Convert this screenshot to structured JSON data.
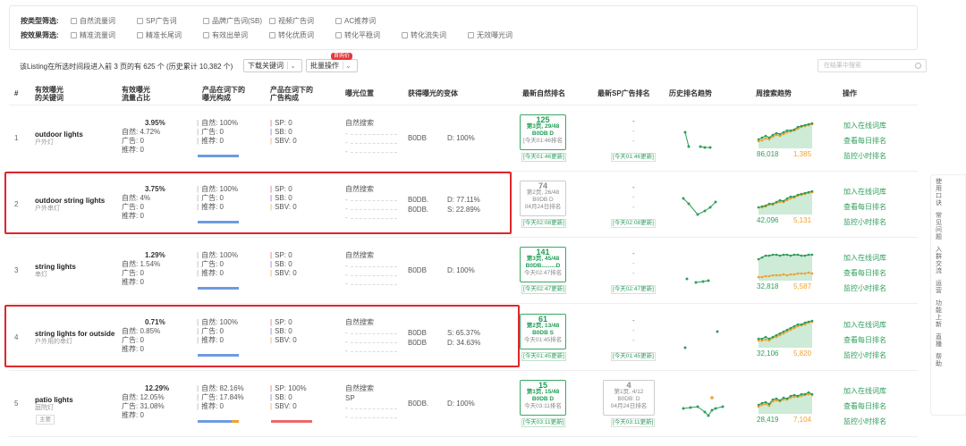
{
  "filters": {
    "type_label": "按类型筛选:",
    "type_options": [
      "自然流量词",
      "SP广告词",
      "品牌广告词(SB)",
      "视频广告词",
      "AC推荐词"
    ],
    "effect_label": "按效果筛选:",
    "effect_options": [
      "精准流量词",
      "精准长尾词",
      "有效出单词",
      "转化优质词",
      "转化平稳词",
      "转化流失词",
      "无效曝光词"
    ]
  },
  "toolbar": {
    "summary": "该Listing在所选时间段进入前 3 页的有 625 个 (历史累计 10,382 个)",
    "download_label": "下载关键词",
    "batch_label": "批量操作",
    "badge": "首购价",
    "search_placeholder": "在结果中搜索"
  },
  "columns": [
    "#",
    "有效曝光\n的关键词",
    "有效曝光\n流量占比",
    "产品在词下的\n曝光构成",
    "产品在词下的\n广告构成",
    "曝光位置",
    "获得曝光的变体",
    "最新自然排名",
    "最新SP广告排名",
    "历史排名趋势",
    "周搜索趋势",
    "操作"
  ],
  "rows": [
    {
      "idx": "1",
      "kw": "outdoor lights",
      "kw_cn": "户外灯",
      "share": "3.95%",
      "nat": "自然: 4.72%",
      "ad": "广告: 0",
      "rec": "推荐: 0",
      "exp_nat": "自然: 100%",
      "exp_ad": "广告: 0",
      "exp_rec": "推荐: 0",
      "sp": "SP: 0",
      "sb": "SB: 0",
      "sbv": "SBV: 0",
      "pos": "自然搜索",
      "var1": "B0DB",
      "var1p": "D: 100%",
      "var2": "",
      "var2p": "",
      "rank_num": "125",
      "rank_l1": "第3页, 29/48",
      "rank_l2": "B0DB          D",
      "rank_l3": "[今天01:46排名",
      "rank_upd": "[今天01:46更新]",
      "sp_rank": "-",
      "sp_upd": "[今天01:46更新]",
      "trend_a": "86,018",
      "trend_b": "1,385"
    },
    {
      "idx": "2",
      "kw": "outdoor string lights",
      "kw_cn": "户外串灯",
      "share": "3.75%",
      "nat": "自然: 4%",
      "ad": "广告: 0",
      "rec": "推荐: 0",
      "exp_nat": "自然: 100%",
      "exp_ad": "广告: 0",
      "exp_rec": "推荐: 0",
      "sp": "SP: 0",
      "sb": "SB: 0",
      "sbv": "SBV: 0",
      "pos": "自然搜索",
      "var1": "B0DB.",
      "var1p": "D: 77.11%",
      "var2": "B0DB.",
      "var2p": "S: 22.89%",
      "rank_num": "74",
      "rank_l1": "第2页, 26/48",
      "rank_l2": "B0DB          D",
      "rank_l3": "04月24日排名",
      "rank_upd": "[今天02:08更新]",
      "sp_rank": "-",
      "sp_upd": "[今天02:08更新]",
      "trend_a": "42,096",
      "trend_b": "5,131"
    },
    {
      "idx": "3",
      "kw": "string lights",
      "kw_cn": "串灯",
      "share": "1.29%",
      "nat": "自然: 1.54%",
      "ad": "广告: 0",
      "rec": "推荐: 0",
      "exp_nat": "自然: 100%",
      "exp_ad": "广告: 0",
      "exp_rec": "推荐: 0",
      "sp": "SP: 0",
      "sb": "SB: 0",
      "sbv": "SBV: 0",
      "pos": "自然搜索",
      "var1": "B0DB",
      "var1p": "D: 100%",
      "var2": "",
      "var2p": "",
      "rank_num": "141",
      "rank_l1": "第3页, 45/48",
      "rank_l2": "B0DB.........D",
      "rank_l3": "今天02:47排名",
      "rank_upd": "[今天02:47更新]",
      "sp_rank": "-",
      "sp_upd": "[今天02:47更新]",
      "trend_a": "32,818",
      "trend_b": "5,587"
    },
    {
      "idx": "4",
      "kw": "string lights for outside",
      "kw_cn": "户外用的串灯",
      "share": "0.71%",
      "nat": "自然: 0.85%",
      "ad": "广告: 0",
      "rec": "推荐: 0",
      "exp_nat": "自然: 100%",
      "exp_ad": "广告: 0",
      "exp_rec": "推荐: 0",
      "sp": "SP: 0",
      "sb": "SB: 0",
      "sbv": "SBV: 0",
      "pos": "自然搜索",
      "var1": "B0DB",
      "var1p": "S: 65.37%",
      "var2": "B0DB",
      "var2p": "D: 34.63%",
      "rank_num": "61",
      "rank_l1": "第2页, 13/48",
      "rank_l2": "B0DB          S",
      "rank_l3": "今天01:45排名",
      "rank_upd": "[今天01:45更新]",
      "sp_rank": "-",
      "sp_upd": "[今天01:45更新]",
      "trend_a": "32,106",
      "trend_b": "5,820"
    },
    {
      "idx": "5",
      "kw": "patio lights",
      "kw_cn": "庭院灯",
      "tag": "主要",
      "share": "12.29%",
      "nat": "自然: 12.05%",
      "ad": "广告: 31.08%",
      "rec": "推荐: 0",
      "exp_nat": "自然: 82.16%",
      "exp_ad": "广告: 17.84%",
      "exp_rec": "推荐: 0",
      "sp": "SP: 100%",
      "sb": "SB: 0",
      "sbv": "SBV: 0",
      "pos": "自然搜索",
      "pos2": "SP",
      "var1": "B0DB.",
      "var1p": "D: 100%",
      "var2": "",
      "var2p": "",
      "rank_num": "15",
      "rank_l1": "第1页, 15/48",
      "rank_l2": "B0DB          D",
      "rank_l3": "今天03:11排名",
      "rank_upd": "[今天03:11更新]",
      "sp_rank": "4",
      "sp_l1": "第1页, 4/12",
      "sp_l2": "B0DB:          D",
      "sp_l3": "04月24日排名",
      "sp_upd": "[今天03:11更新]",
      "trend_a": "28,419",
      "trend_b": "7,104"
    }
  ],
  "ops": [
    "加入在线词库",
    "查看每日排名",
    "监控小时排名"
  ],
  "side_panel": [
    "使用口诀",
    "常见问题",
    "入群交流",
    "运营",
    "功能上新",
    "直播",
    "帮助"
  ],
  "colors": {
    "accent": "#2e9e5b",
    "highlight": "#e0262c",
    "blue_bar": "#6f9be0",
    "orange": "#f0a032"
  }
}
